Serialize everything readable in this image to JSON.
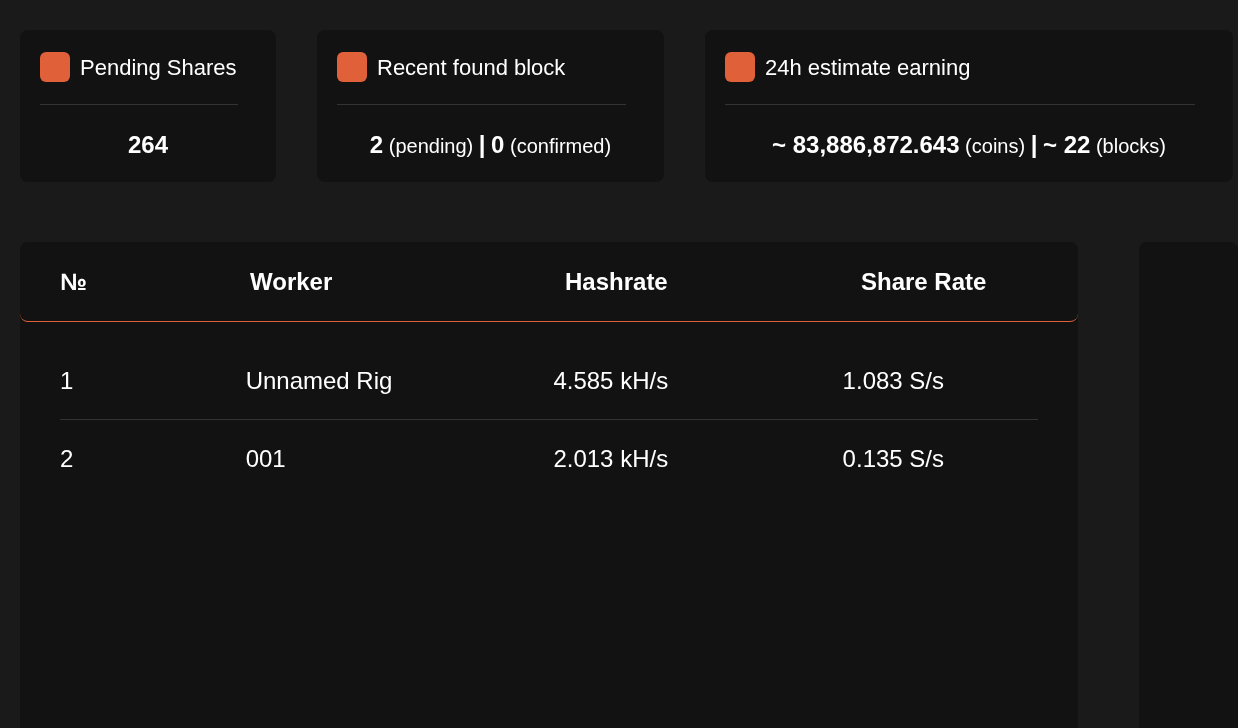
{
  "stats": [
    {
      "title": "Pending Shares",
      "value": "**264**"
    },
    {
      "title": "Recent found block",
      "value": "**2** (pending) **|** **0** (confirmed)"
    },
    {
      "title": "24h estimate earning",
      "value": "**~ 83,886,872.643** (coins) **|** **~ 22** (blocks)"
    }
  ],
  "table": {
    "columns": [
      "№",
      "Worker",
      "Hashrate",
      "Share Rate"
    ],
    "rows": [
      [
        "1",
        "Unnamed Rig",
        "4.585 kH/s",
        "1.083 S/s"
      ],
      [
        "2",
        "001",
        "2.013 kH/s",
        "0.135 S/s"
      ]
    ]
  }
}
